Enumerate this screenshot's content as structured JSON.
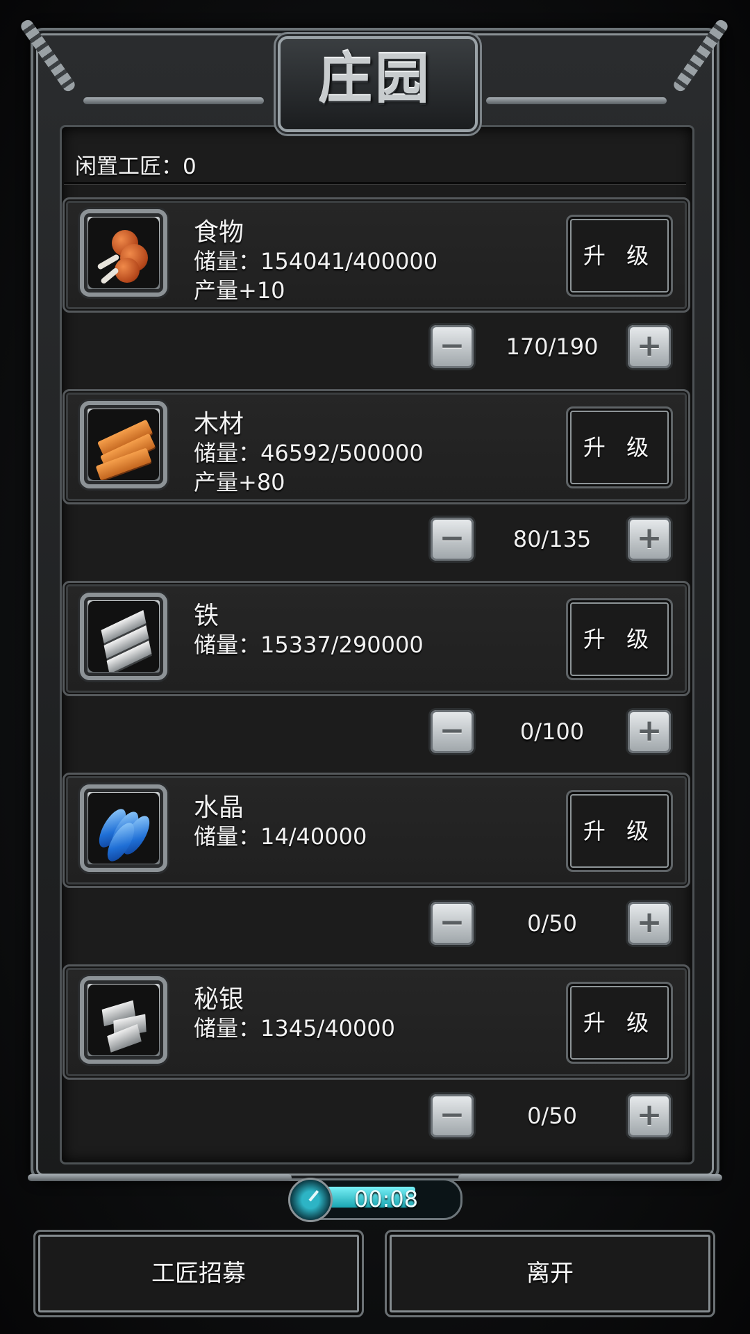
{
  "title": "庄园",
  "idle_label": "闲置工匠：0",
  "resources": [
    {
      "name": "食物",
      "storage": "储量：154041/400000",
      "production": "产量+10",
      "upgrade": "升 级",
      "stepper": "170/190",
      "icon": "meat-icon"
    },
    {
      "name": "木材",
      "storage": "储量：46592/500000",
      "production": "产量+80",
      "upgrade": "升 级",
      "stepper": "80/135",
      "icon": "wood-icon"
    },
    {
      "name": "铁",
      "storage": "储量：15337/290000",
      "production": "",
      "upgrade": "升 级",
      "stepper": "0/100",
      "icon": "iron-icon"
    },
    {
      "name": "水晶",
      "storage": "储量：14/40000",
      "production": "",
      "upgrade": "升 级",
      "stepper": "0/50",
      "icon": "crystal-icon"
    },
    {
      "name": "秘银",
      "storage": "储量：1345/40000",
      "production": "",
      "upgrade": "升 级",
      "stepper": "0/50",
      "icon": "mithril-icon"
    }
  ],
  "stepper_minus": "−",
  "stepper_plus": "+",
  "timer": {
    "text": "00:08",
    "fill_fraction": 0.72
  },
  "buttons": {
    "recruit": "工匠招募",
    "leave": "离开"
  },
  "colors": {
    "accent": "#1aa6b2",
    "frame": "#8b9296"
  }
}
